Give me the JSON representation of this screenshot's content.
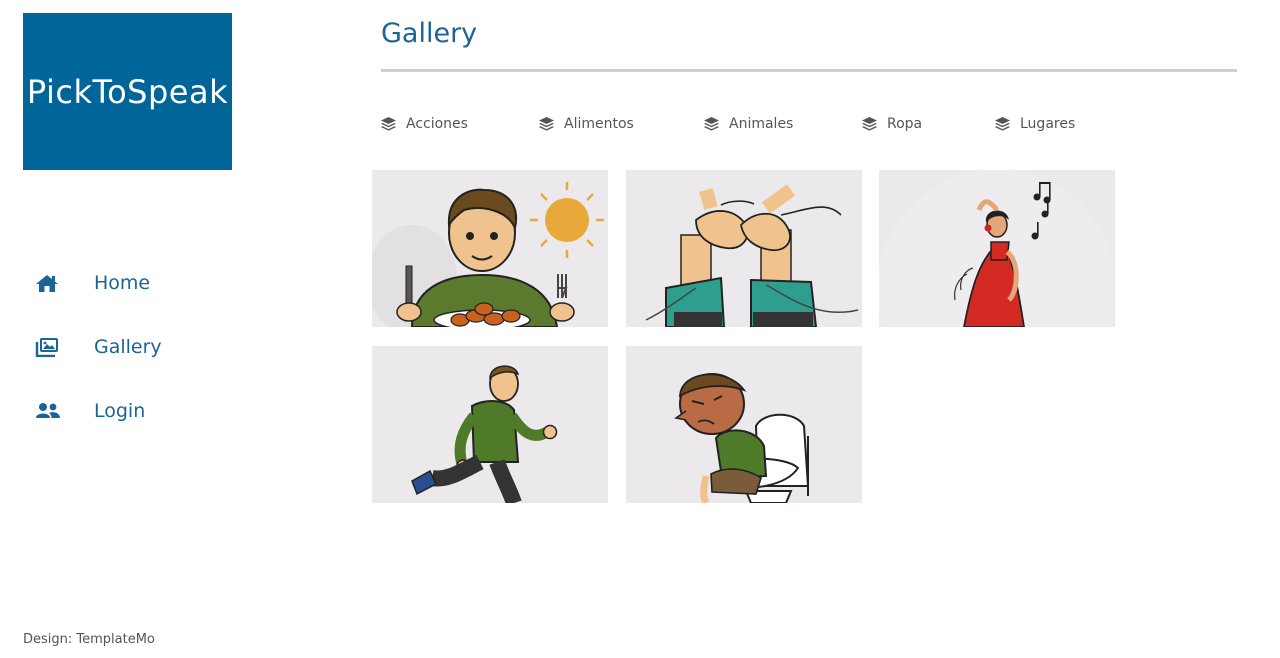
{
  "brand": {
    "logo_text": "PickToSpeak",
    "color": "#006699"
  },
  "nav": {
    "items": [
      {
        "label": "Home",
        "icon": "home-icon"
      },
      {
        "label": "Gallery",
        "icon": "images-icon"
      },
      {
        "label": "Login",
        "icon": "users-icon"
      }
    ]
  },
  "page": {
    "title": "Gallery"
  },
  "filters": [
    {
      "label": "Acciones",
      "icon": "layers-icon"
    },
    {
      "label": "Alimentos",
      "icon": "layers-icon"
    },
    {
      "label": "Animales",
      "icon": "layers-icon"
    },
    {
      "label": "Ropa",
      "icon": "layers-icon"
    },
    {
      "label": "Lugares",
      "icon": "layers-icon"
    }
  ],
  "gallery": {
    "images": [
      {
        "subject": "boy-eating-icon"
      },
      {
        "subject": "tying-shoes-icon"
      },
      {
        "subject": "dancing-woman-icon"
      },
      {
        "subject": "running-boy-icon"
      },
      {
        "subject": "boy-on-toilet-icon"
      }
    ]
  },
  "footer": {
    "credit": "Design: TemplateMo"
  },
  "colors": {
    "accent": "#1b6496",
    "rule": "#cfcfcf",
    "tile_bg": "#ebe9ec"
  }
}
